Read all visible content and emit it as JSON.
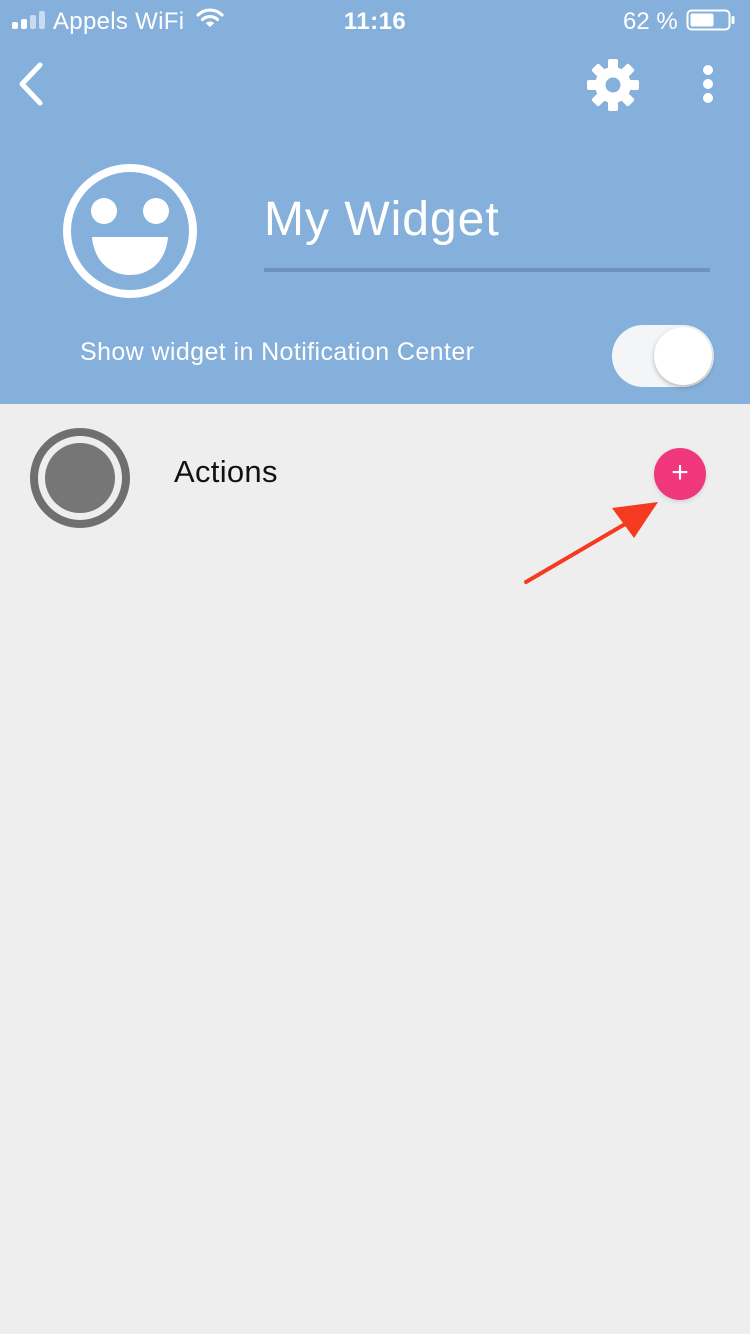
{
  "status_bar": {
    "carrier": "Appels WiFi",
    "time": "11:16",
    "battery": "62 %",
    "icons": [
      "signal-icon",
      "wifi-icon",
      "battery-icon"
    ]
  },
  "nav": {
    "back_icon": "chevron-left-icon",
    "settings_icon": "gear-icon",
    "more_icon": "more-vertical-icon"
  },
  "widget": {
    "icon": "smiley-face-icon",
    "name": "My Widget",
    "show_in_notification_center_label": "Show widget in Notification Center",
    "show_in_notification_center": true
  },
  "actions": {
    "label": "Actions",
    "icon": "record-circle-icon",
    "add_label": "+"
  },
  "colors": {
    "header": "#85b0db",
    "background": "#efeeef",
    "accent": "#f0367c",
    "annotation_arrow": "#f53a1f"
  }
}
